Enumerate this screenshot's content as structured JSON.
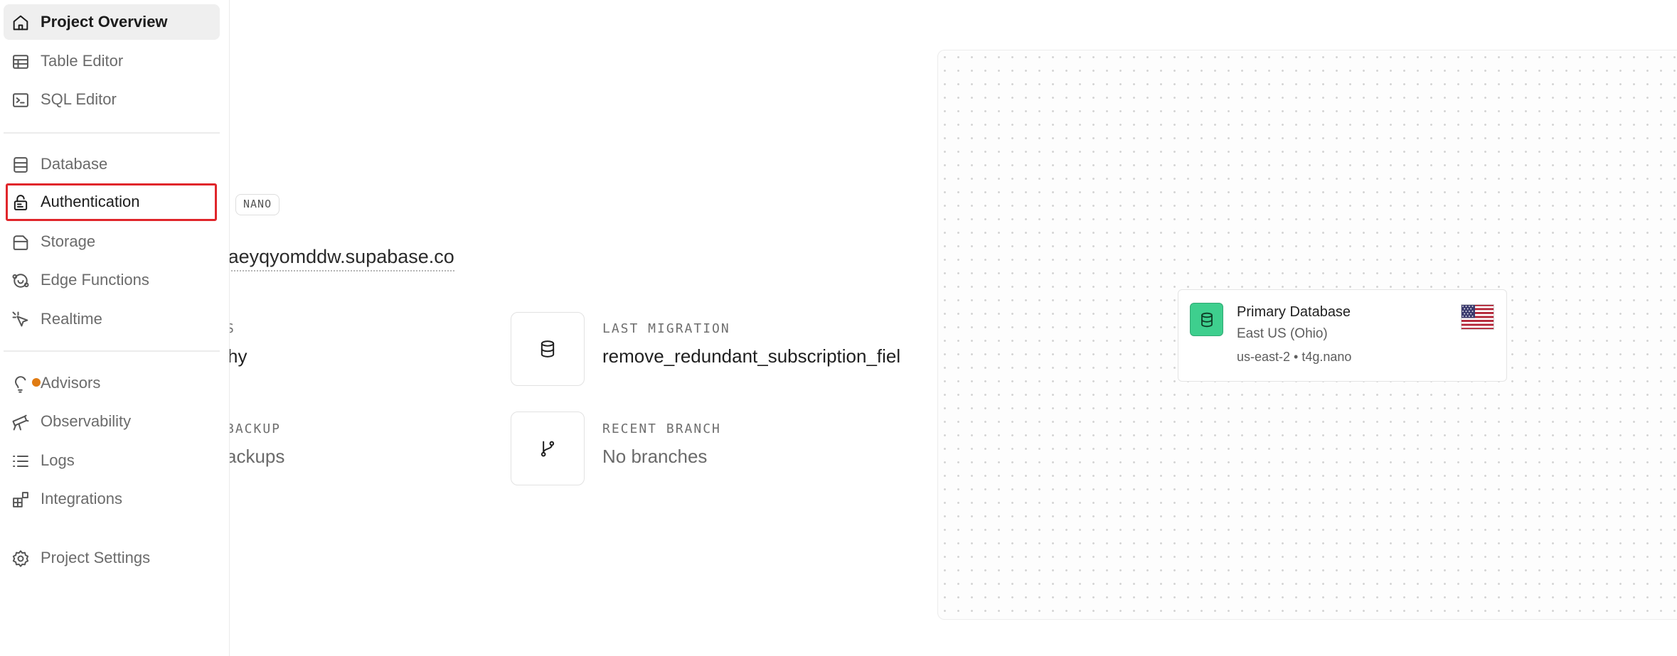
{
  "sidebar": {
    "items": [
      {
        "label": "Project Overview",
        "icon": "home-icon",
        "state": "active"
      },
      {
        "label": "Table Editor",
        "icon": "table-icon"
      },
      {
        "label": "SQL Editor",
        "icon": "terminal-icon"
      },
      {
        "label": "Database",
        "icon": "database-icon"
      },
      {
        "label": "Authentication",
        "icon": "lock-icon",
        "state": "highlighted"
      },
      {
        "label": "Storage",
        "icon": "storage-icon"
      },
      {
        "label": "Edge Functions",
        "icon": "edge-functions-icon"
      },
      {
        "label": "Realtime",
        "icon": "cursor-icon"
      },
      {
        "label": "Advisors",
        "icon": "lightbulb-icon",
        "badge_color": "#e07b12"
      },
      {
        "label": "Observability",
        "icon": "telescope-icon"
      },
      {
        "label": "Logs",
        "icon": "list-icon"
      },
      {
        "label": "Integrations",
        "icon": "blocks-icon"
      },
      {
        "label": "Project Settings",
        "icon": "gear-icon"
      }
    ]
  },
  "overview": {
    "compute_badge": "NANO",
    "project_url": "ygeajjdnaeyqyomddw.supabase.co",
    "stats": [
      {
        "label": "S",
        "value": "hy"
      },
      {
        "label": "LAST MIGRATION",
        "value": "remove_redundant_subscription_fiel",
        "icon": "database-icon"
      },
      {
        "label": "BACKUP",
        "value": "ackups"
      },
      {
        "label": "RECENT BRANCH",
        "value": "No branches",
        "icon": "git-branch-icon"
      }
    ]
  },
  "infrastructure": {
    "primary_db": {
      "title": "Primary Database",
      "region": "East US (Ohio)",
      "meta": "us-east-2 • t4g.nano",
      "flag": "us-flag-icon",
      "accent": "#3ecf8e"
    }
  },
  "colors": {
    "highlight_outline": "#e0262b",
    "active_bg": "#efefef"
  }
}
